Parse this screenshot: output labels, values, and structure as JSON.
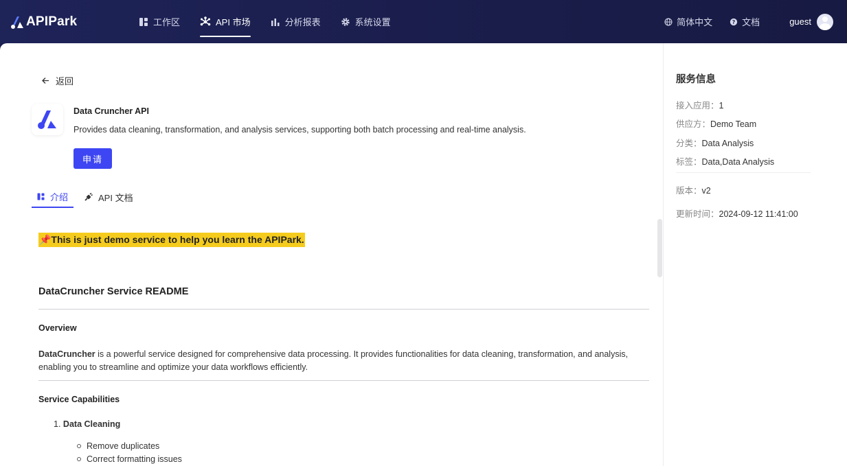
{
  "header": {
    "logo_text": "APIPark",
    "nav": [
      {
        "label": "工作区",
        "icon": "workspace-icon"
      },
      {
        "label": "API 市场",
        "icon": "market-icon",
        "active": true
      },
      {
        "label": "分析报表",
        "icon": "bar-chart-icon"
      },
      {
        "label": "系统设置",
        "icon": "gear-icon"
      }
    ],
    "language": "简体中文",
    "docs": "文档",
    "username": "guest"
  },
  "service": {
    "back_label": "返回",
    "title": "Data Cruncher API",
    "description": "Provides data cleaning, transformation, and analysis services, supporting both batch processing and real-time analysis.",
    "apply_label": "申请"
  },
  "tabs": [
    {
      "label": "介绍",
      "active": true
    },
    {
      "label": "API 文档",
      "active": false
    }
  ],
  "doc": {
    "banner": "📌This is just demo service to help you learn the APIPark.",
    "heading": "DataCruncher Service README",
    "overview_heading": "Overview",
    "overview_bold": "DataCruncher",
    "overview_text": " is a powerful service designed for comprehensive data processing. It provides functionalities for data cleaning, transformation, and analysis, enabling you to streamline and optimize your data workflows efficiently.",
    "capabilities_heading": "Service Capabilities",
    "capability_number": "1.",
    "capability_1": "Data Cleaning",
    "capability_1_items": [
      "Remove duplicates",
      "Correct formatting issues"
    ]
  },
  "info": {
    "title": "服务信息",
    "apps_label": "接入应用：",
    "apps_value": "1",
    "provider_label": "供应方：",
    "provider_value": "Demo Team",
    "category_label": "分类：",
    "category_value": "Data Analysis",
    "tags_label": "标签：",
    "tags_value": "Data,Data Analysis",
    "version_label": "版本：",
    "version_value": "v2",
    "updated_label": "更新时间：",
    "updated_value": "2024-09-12 11:41:00"
  },
  "colors": {
    "primary": "#3d46f2",
    "header_bg": "#1a1d4a",
    "highlight": "#f5cc1d"
  }
}
